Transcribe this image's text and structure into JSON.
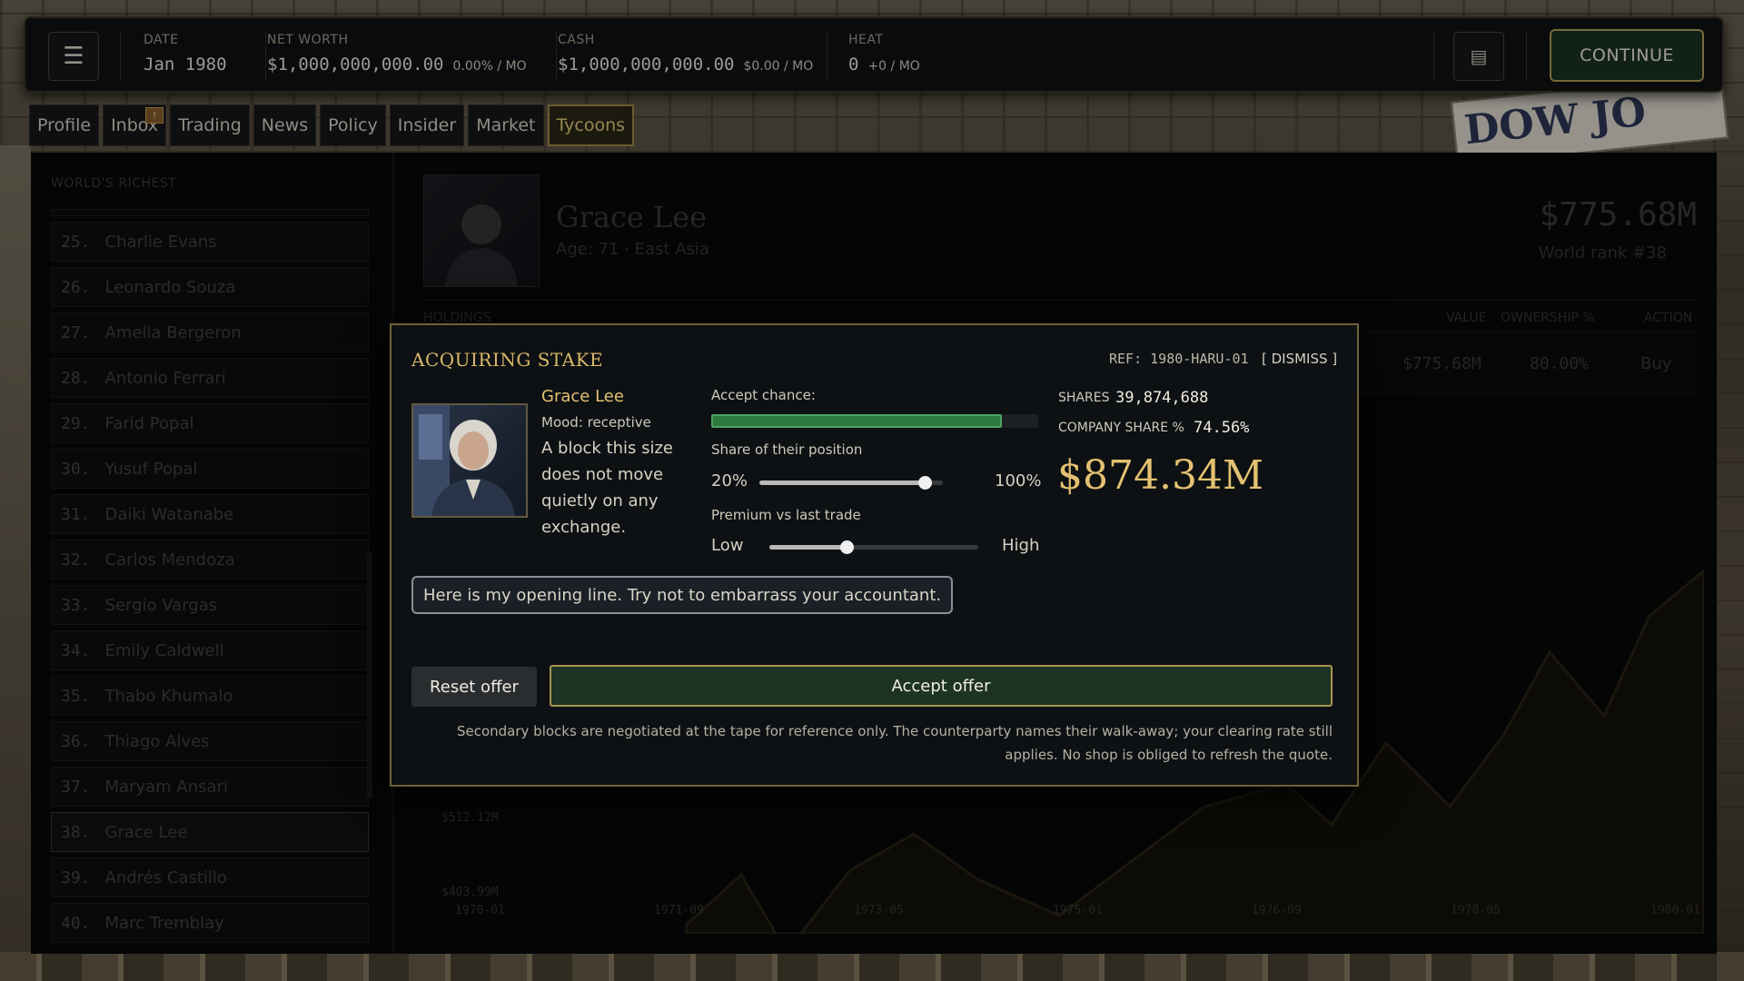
{
  "topbar": {
    "date_label": "DATE",
    "date_value": "Jan 1980",
    "networth_label": "NET WORTH",
    "networth_value": "$1,000,000,000.00",
    "networth_rate": "0.00% / MO",
    "cash_label": "CASH",
    "cash_value": "$1,000,000,000.00",
    "cash_rate": "$0.00 / MO",
    "heat_label": "HEAT",
    "heat_value": "0",
    "heat_rate": "+0 / MO",
    "continue_label": "CONTINUE",
    "menu_icon": "hamburger-menu-icon",
    "log_icon": "ledger-icon"
  },
  "tabs": [
    {
      "label": "Profile",
      "active": false
    },
    {
      "label": "Inbox",
      "active": false,
      "badge": "!"
    },
    {
      "label": "Trading",
      "active": false
    },
    {
      "label": "News",
      "active": false
    },
    {
      "label": "Policy",
      "active": false
    },
    {
      "label": "Insider",
      "active": false
    },
    {
      "label": "Market",
      "active": false
    },
    {
      "label": "Tycoons",
      "active": true
    }
  ],
  "richest": {
    "title": "WORLD'S RICHEST",
    "items": [
      {
        "rank": "25.",
        "name": "Charlie Evans"
      },
      {
        "rank": "26.",
        "name": "Leonardo Souza"
      },
      {
        "rank": "27.",
        "name": "Amelia Bergeron"
      },
      {
        "rank": "28.",
        "name": "Antonio Ferrari"
      },
      {
        "rank": "29.",
        "name": "Farid Popal"
      },
      {
        "rank": "30.",
        "name": "Yusuf Popal"
      },
      {
        "rank": "31.",
        "name": "Daiki Watanabe"
      },
      {
        "rank": "32.",
        "name": "Carlos Mendoza"
      },
      {
        "rank": "33.",
        "name": "Sergio Vargas"
      },
      {
        "rank": "34.",
        "name": "Emily Caldwell"
      },
      {
        "rank": "35.",
        "name": "Thabo Khumalo"
      },
      {
        "rank": "36.",
        "name": "Thiago Alves"
      },
      {
        "rank": "37.",
        "name": "Maryam Ansari"
      },
      {
        "rank": "38.",
        "name": "Grace Lee",
        "selected": true
      },
      {
        "rank": "39.",
        "name": "Andrés Castillo"
      },
      {
        "rank": "40.",
        "name": "Marc Tremblay"
      }
    ]
  },
  "profile": {
    "name": "Grace Lee",
    "subtitle": "Age: 71 · East Asia",
    "net_worth": "$775.68M",
    "world_rank": "World rank #38",
    "holdings_label": "HOLDINGS",
    "col_value": "VALUE",
    "col_ownership": "OWNERSHIP %",
    "col_action": "ACTION",
    "row_value": "$775.68M",
    "row_ownership": "80.00%",
    "row_action": "Buy"
  },
  "chart_data": {
    "type": "area",
    "x_ticks": [
      "1970-01",
      "1971-09",
      "1973-05",
      "1975-01",
      "1976-09",
      "1978-05",
      "1980-01"
    ],
    "y_ticks": [
      "$512.12M",
      "$403.99M"
    ]
  },
  "modal": {
    "title": "ACQUIRING STAKE",
    "ref": "REF: 1980-HARU-01",
    "dismiss": "[ DISMISS ]",
    "counterparty_name": "Grace Lee",
    "mood": "Mood: receptive",
    "quote": "A block this size does not move quietly on any exchange.",
    "accept_chance_label": "Accept chance:",
    "accept_chance": 0.89,
    "share_label": "Share of their position",
    "share_min": "20%",
    "share_max": "100%",
    "share_fraction": 0.9,
    "premium_label": "Premium vs last trade",
    "premium_min": "Low",
    "premium_max": "High",
    "premium_fraction": 0.37,
    "shares_label": "SHARES",
    "shares_value": "39,874,688",
    "company_share_label": "COMPANY SHARE %",
    "company_share_value": "74.56%",
    "price": "$874.34M",
    "opening_line": "Here is my opening line. Try not to embarrass your accountant.",
    "reset_label": "Reset offer",
    "accept_label": "Accept offer",
    "disclaimer": "Secondary blocks are negotiated at the tape for reference only. The counterparty names their walk-away; your clearing rate still applies. No shop is obliged to refresh the quote."
  }
}
